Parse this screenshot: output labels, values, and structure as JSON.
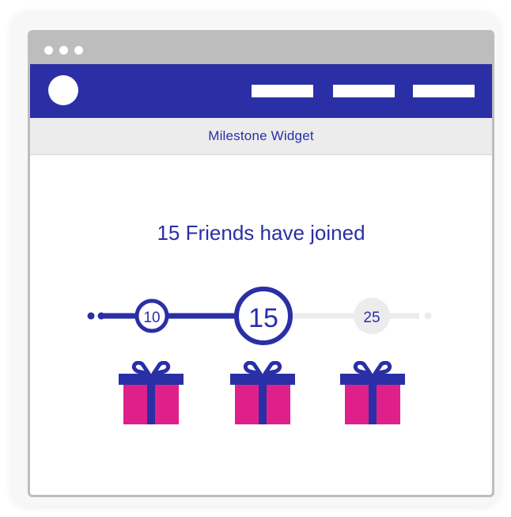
{
  "widget": {
    "title": "Milestone Widget",
    "headline": "15 Friends have joined"
  },
  "milestones": [
    {
      "value": "10",
      "state": "reached",
      "gift": "gift-icon"
    },
    {
      "value": "15",
      "state": "current",
      "gift": "gift-icon"
    },
    {
      "value": "25",
      "state": "upcoming",
      "gift": "gift-icon"
    }
  ],
  "colors": {
    "accent": "#2a2fa6",
    "gift": "#e0208a",
    "inactive": "#ececec"
  }
}
